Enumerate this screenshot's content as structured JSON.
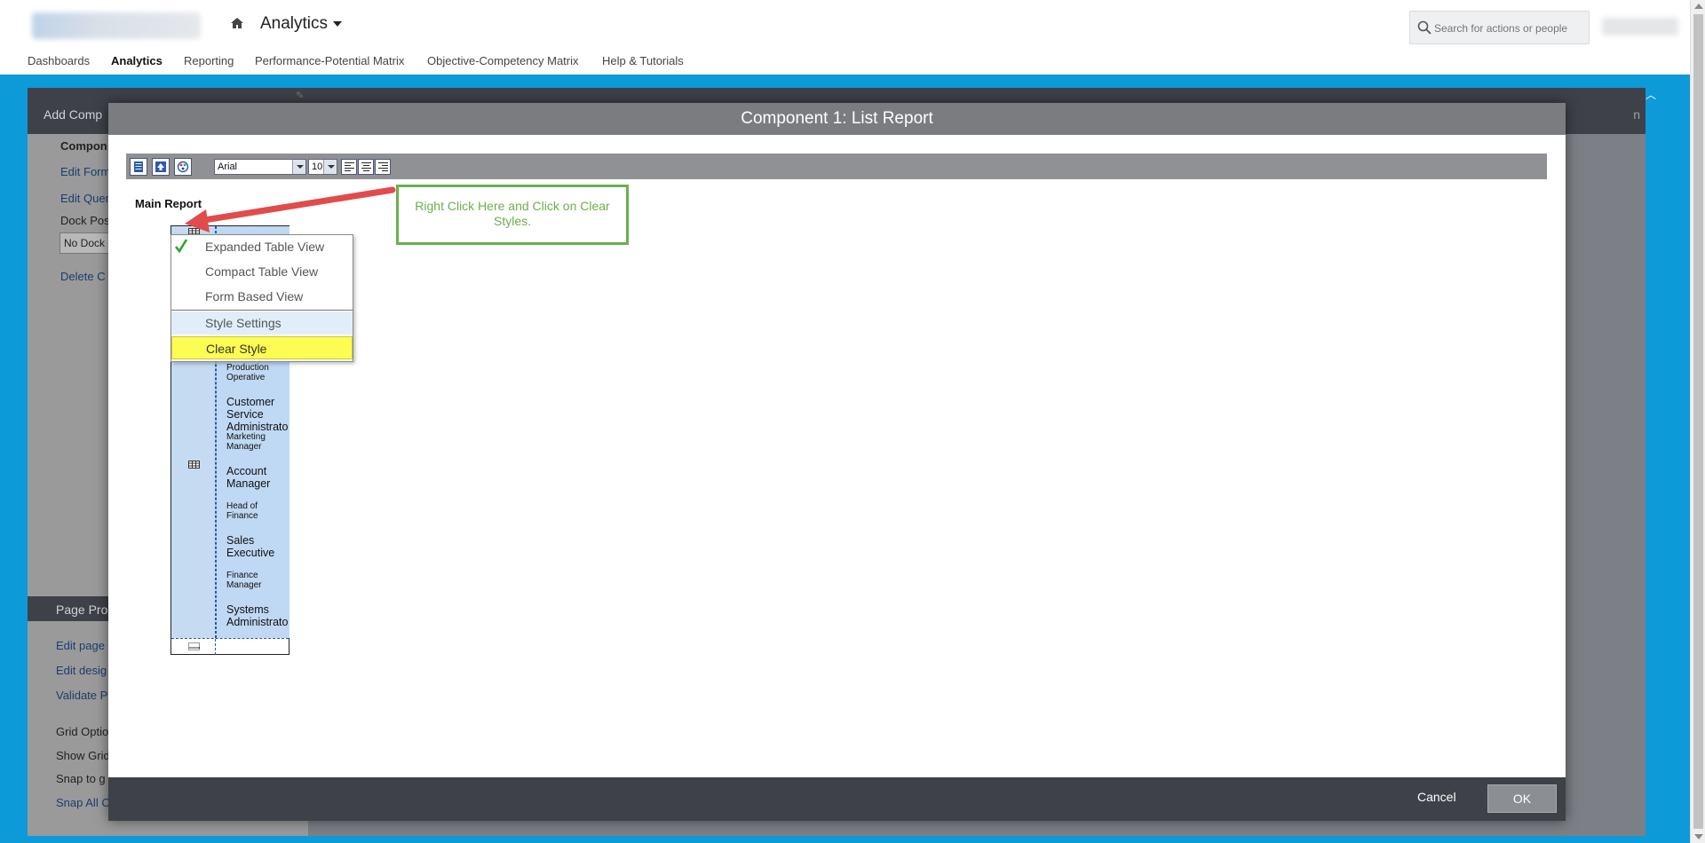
{
  "header": {
    "app_title": "Analytics",
    "search_placeholder": "Search for actions or people"
  },
  "nav": {
    "items": [
      {
        "label": "Dashboards"
      },
      {
        "label": "Analytics",
        "active": true
      },
      {
        "label": "Reporting"
      },
      {
        "label": "Performance-Potential Matrix"
      },
      {
        "label": "Objective-Competency Matrix"
      },
      {
        "label": "Help & Tutorials"
      }
    ]
  },
  "underlying": {
    "panel_title": "Add Comp",
    "component_label": "Compon",
    "edit_form": "Edit Form",
    "edit_query": "Edit Quer",
    "dock_label": "Dock Pos",
    "dock_value": "No Dock",
    "delete": "Delete C",
    "page_props": "Page Pro",
    "edit_page": "Edit page",
    "edit_design": "Edit desig",
    "validate": "Validate P",
    "grid_options": "Grid Optio",
    "show_grid": "Show Grid",
    "snap_to": "Snap to g",
    "snap_all": "Snap All C",
    "right_header": "n"
  },
  "modal": {
    "title": "Component 1: List Report",
    "toolbar": {
      "font": "Arial",
      "size": "10"
    },
    "main_report_label": "Main Report",
    "report_rows": [
      {
        "text": "Production Operative",
        "size": "small"
      },
      {
        "text": "Customer Service Administrato",
        "size": "big"
      },
      {
        "text": "Marketing Manager",
        "size": "small"
      },
      {
        "text": "Account Manager",
        "size": "big"
      },
      {
        "text": "Head of Finance",
        "size": "small"
      },
      {
        "text": "Sales Executive",
        "size": "big"
      },
      {
        "text": "Finance Manager",
        "size": "small"
      },
      {
        "text": "Systems Administrato",
        "size": "big"
      }
    ],
    "context_menu": {
      "expanded": "Expanded Table View",
      "compact": "Compact Table View",
      "form": "Form Based View",
      "style_settings": "Style Settings",
      "clear_style": "Clear Style"
    },
    "callout": "Right Click Here and Click on Clear Styles.",
    "cancel_label": "Cancel",
    "ok_label": "OK"
  },
  "colors": {
    "brand_blue": "#0d9ad8",
    "callout_green": "#6ab04c",
    "arrow_red": "#e24b4b",
    "highlight_yellow": "#fcfc52"
  }
}
